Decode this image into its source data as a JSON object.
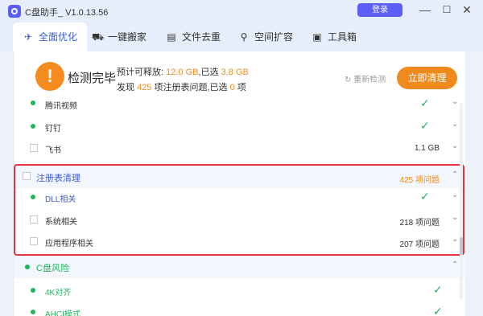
{
  "app": {
    "title": "C盘助手_ V1.0.13.56",
    "login_label": "登录",
    "minimize_glyph": "—",
    "maximize_glyph": "☐",
    "close_glyph": "✕"
  },
  "tabs": [
    {
      "label": "全面优化",
      "icon": "rocket-icon",
      "glyph": "✈"
    },
    {
      "label": "一键搬家",
      "icon": "truck-icon",
      "glyph": "⛟"
    },
    {
      "label": "文件去重",
      "icon": "file-icon",
      "glyph": "▤"
    },
    {
      "label": "空间扩容",
      "icon": "network-icon",
      "glyph": "⚲"
    },
    {
      "label": "工具箱",
      "icon": "toolbox-icon",
      "glyph": "▣"
    }
  ],
  "summary": {
    "title": "检测完毕",
    "line1_prefix": "预计可释放:",
    "line1_size": "12.0 GB",
    "line1_mid": ",已选",
    "line1_selected": "3.8 GB",
    "line2_prefix": "发现",
    "line2_count": "425",
    "line2_mid": "项注册表问题,已选",
    "line2_selected": "0",
    "line2_suffix": "项",
    "recheck_label": "重新检测",
    "clean_label": "立即清理"
  },
  "items": {
    "tencent_video": {
      "label": "腾讯视频"
    },
    "dingding": {
      "label": "钉钉"
    },
    "feishu": {
      "label": "飞书",
      "size": "1.1 GB"
    },
    "registry_section": {
      "label": "注册表清理",
      "count": "425 项问题"
    },
    "dll": {
      "label": "DLL相关"
    },
    "system": {
      "label": "系统相关",
      "count": "218 项问题"
    },
    "apps": {
      "label": "应用程序相关",
      "count": "207 项问题"
    },
    "c_risk_section": {
      "label": "C盘风险"
    },
    "align_4k": {
      "label": "4K对齐"
    },
    "ahci": {
      "label": "AHCI模式"
    }
  },
  "colors": {
    "accent": "#3a5bd9",
    "brand": "#5b5ff6",
    "warning": "#f08a1c",
    "success": "#22b35d",
    "highlight_border": "#e3343c"
  }
}
